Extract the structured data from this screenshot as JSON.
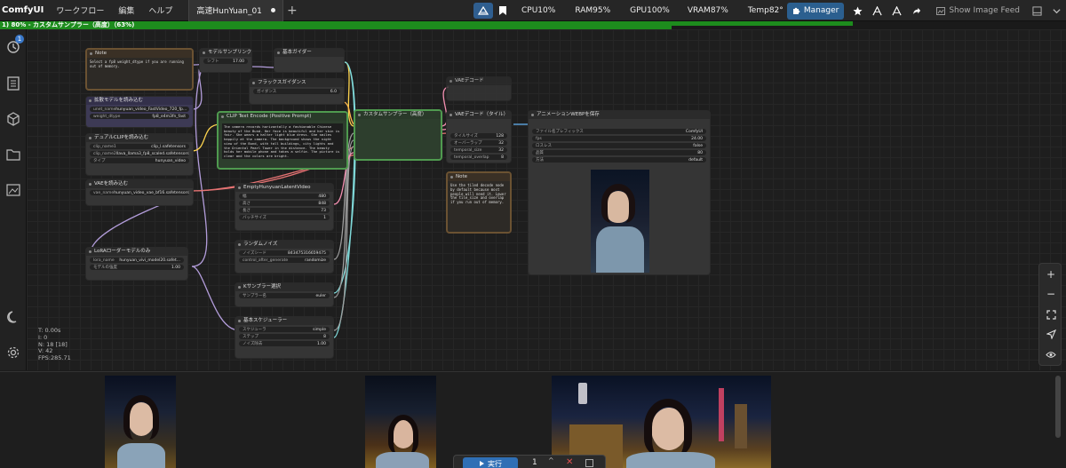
{
  "app": {
    "brand": "ComfyUI",
    "menu": [
      "ワークフロー",
      "編集",
      "ヘルプ"
    ],
    "tab_title": "高速HunYuan_01"
  },
  "stats": {
    "cpu": "CPU10%",
    "ram": "RAM95%",
    "gpu": "GPU100%",
    "vram": "VRAM87%",
    "temp": "Temp82°"
  },
  "toolbar": {
    "manager_label": "Manager",
    "feed_label": "Show Image Feed"
  },
  "progress": {
    "text": "1) 80% - カスタムサンプラー（高度）（63%)",
    "overall": 0.8,
    "step": 0.63
  },
  "sidebar": {
    "queue_badge": "1"
  },
  "canvas_stats": {
    "t": "T: 0.00s",
    "i": "I: 0",
    "n": "N: 18 [18]",
    "v": "V: 42",
    "fps": "FPS:285.71"
  },
  "nodes": {
    "note1": {
      "title": "Note",
      "text": "Select a fp8 weight_dtype if you are running out of memory."
    },
    "sampling_sd3": {
      "title": "モデルサンプリングSD3",
      "w_label": "シフト",
      "w_value": "17.00"
    },
    "basic_guider": {
      "title": "基本ガイダー"
    },
    "flux_guidance": {
      "title": "フラックスガイダンス",
      "w_label": "ガイダンス",
      "w_value": "6.0"
    },
    "load_diffusion": {
      "title": "拡散モデルを読み込む",
      "rows": [
        {
          "label": "unet_name",
          "value": "hunyuan_video_FastVideo_720_fp..."
        },
        {
          "label": "weight_dtype",
          "value": "fp8_e4m3fn_fast"
        }
      ]
    },
    "dual_clip": {
      "title": "デュアルCLIPを読み込む",
      "rows": [
        {
          "label": "clip_name1",
          "value": "clip_l.safetensors"
        },
        {
          "label": "clip_name2",
          "value": "llava_llama3_fp8_scaled.safetensors"
        },
        {
          "label": "タイプ",
          "value": "hunyuan_video"
        }
      ]
    },
    "load_vae": {
      "title": "VAEを読み込む",
      "rows": [
        {
          "label": "vae_name",
          "value": "hunyuan_video_vae_bf16.safetensors"
        }
      ]
    },
    "lora": {
      "title": "LoRAローダーモデルのみ",
      "rows": [
        {
          "label": "lora_name",
          "value": "hunyuan_vivi_model20.safet..."
        },
        {
          "label": "モデルの強度",
          "value": "1.00"
        }
      ]
    },
    "clip_text": {
      "title": "CLIP Text Encode (Positive Prompt)",
      "text": "The camera records horizontally a fashionable Chinese beauty of the Bund. Her face is beautiful and her skin is fair. She wears a halter light blue dress. She smiles happily at the camera. The background shows the night view of the Bund, with tall buildings, city lights and the Oriental Pearl Tower in the distance. The beauty holds her mobile phone and takes a selfie. The picture is clear and the colors are bright."
    },
    "custom_sampler": {
      "title": "カスタムサンプラー（高度）"
    },
    "empty_latent": {
      "title": "EmptyHunyuanLatentVideo",
      "rows": [
        {
          "label": "幅",
          "value": "480"
        },
        {
          "label": "高さ",
          "value": "848"
        },
        {
          "label": "長さ",
          "value": "73"
        },
        {
          "label": "バッチサイズ",
          "value": "1"
        }
      ]
    },
    "random_noise": {
      "title": "ランダムノイズ",
      "rows": [
        {
          "label": "ノイズシード",
          "value": "843475316659475"
        },
        {
          "label": "control_after_generate",
          "value": "randomize"
        }
      ]
    },
    "ksampler_select": {
      "title": "Kサンプラー選択",
      "rows": [
        {
          "label": "サンプラー名",
          "value": "euler"
        }
      ]
    },
    "basic_scheduler": {
      "title": "基本スケジューラー",
      "rows": [
        {
          "label": "スケジューラ",
          "value": "simple"
        },
        {
          "label": "ステップ",
          "value": "8"
        },
        {
          "label": "ノイズ除去",
          "value": "1.00"
        }
      ]
    },
    "vae_decode": {
      "title": "VAEデコード"
    },
    "vae_decode_tiled": {
      "title": "VAEデコード（タイル）",
      "rows": [
        {
          "label": "タイルサイズ",
          "value": "128"
        },
        {
          "label": "オーバーラップ",
          "value": "32"
        },
        {
          "label": "temporal_size",
          "value": "32"
        },
        {
          "label": "temporal_overlap",
          "value": "8"
        }
      ]
    },
    "note2": {
      "title": "Note",
      "text": "Use the tiled decode node by default because most people will need it. Lower the tile_size and overlap if you run out of memory."
    },
    "animated_webp": {
      "title": "アニメーションWEBPを保存",
      "rows": [
        {
          "label": "ファイル名プレフィックス",
          "value": "ComfyUI"
        },
        {
          "label": "fps",
          "value": "24.00"
        },
        {
          "label": "ロスレス",
          "value": "false"
        },
        {
          "label": "品質",
          "value": "80"
        },
        {
          "label": "方法",
          "value": "default"
        }
      ]
    }
  },
  "run": {
    "label": "実行",
    "count": "1"
  },
  "colors": {
    "accent": "#2f6fb5",
    "progress": "#1d8c1d",
    "note_border": "#6b5232",
    "node_bg": "#353535"
  }
}
